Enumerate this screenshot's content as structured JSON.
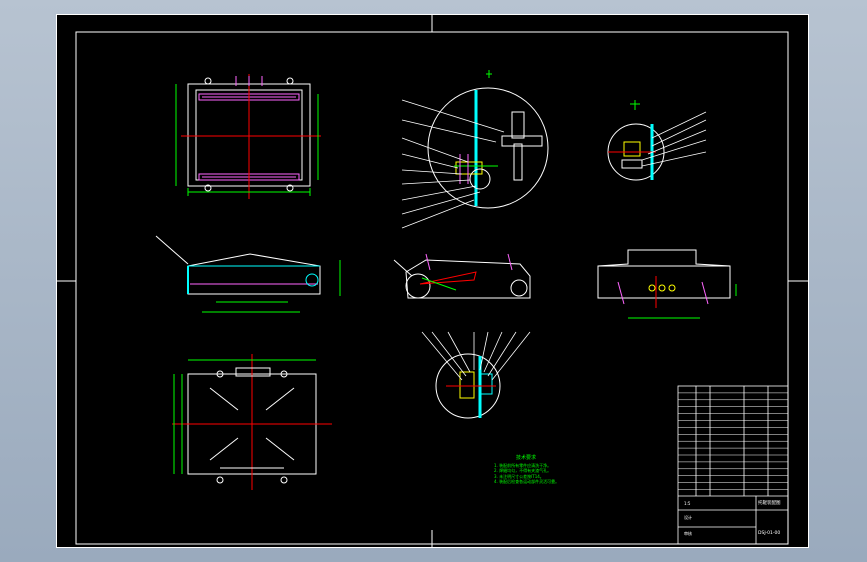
{
  "colors": {
    "background": "#000000",
    "frame": "#ffffff",
    "outline": "#ffffff",
    "dimension": "#00ff00",
    "centerline": "#ff0000",
    "component": "#ff66ff",
    "highlight": "#00ffff",
    "part": "#ffff00",
    "notes": "#00ff00"
  },
  "notes": {
    "title": "技术要求",
    "lines": [
      "1. 装配前所有零件应清洗干净。",
      "2. 焊缝均匀，不得有夹渣气孔。",
      "3. 未注明尺寸公差按IT14。",
      "4. 装配后检查各运动部件灵活可靠。"
    ]
  },
  "title_block": {
    "drawing_title": "托辊装配图",
    "drawing_number": "DSJ-01-00",
    "scale": "1:5",
    "designer": "设计",
    "checker": "审核"
  }
}
